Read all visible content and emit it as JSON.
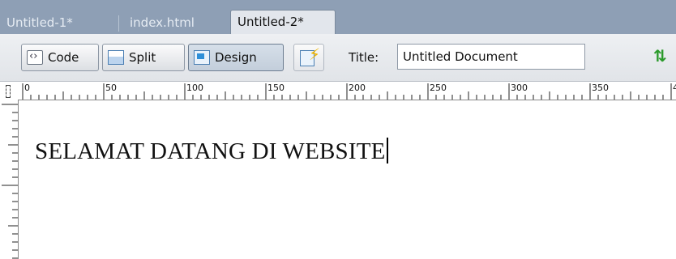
{
  "tabs": [
    {
      "label": "Untitled-1*",
      "active": false
    },
    {
      "label": "index.html",
      "active": false
    },
    {
      "label": "Untitled-2*",
      "active": true
    }
  ],
  "toolbar": {
    "code_label": "Code",
    "split_label": "Split",
    "design_label": "Design",
    "active_view": "Design",
    "title_label": "Title:",
    "title_value": "Untitled Document"
  },
  "ruler": {
    "labels": [
      "0",
      "50",
      "100",
      "150",
      "200",
      "250",
      "300",
      "350",
      "4"
    ]
  },
  "document": {
    "text": "SELAMAT DATANG DI WEBSITE"
  },
  "colors": {
    "tabbar_bg": "#8e9fb5",
    "active_tab_bg": "#e2e6ec",
    "accent_blue": "#2f8fd8",
    "sort_icon_green": "#2a9a2a"
  }
}
